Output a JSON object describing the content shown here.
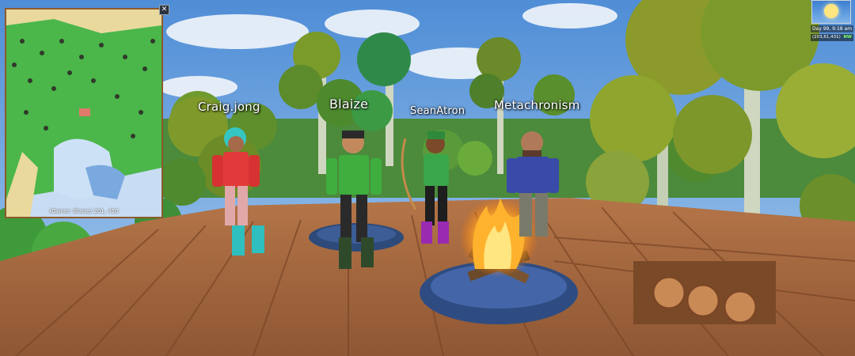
{
  "players": [
    {
      "name": "Craig.jong"
    },
    {
      "name": "Blaize"
    },
    {
      "name": "SeanAtron"
    },
    {
      "name": "Metachronism"
    }
  ],
  "minimap": {
    "owner_label": "(Owner: Blaize) 201, 450",
    "close_label": "✕"
  },
  "hud": {
    "day_time": "Day 99, 9:18 am",
    "coords": "(203,61,431)",
    "compass": "NW",
    "weather_icon": "sun-icon"
  },
  "colors": {
    "sky": "#6ea3d8",
    "deck": "#a86a3f",
    "foliage": "#6f9a2e",
    "fire": "#ffb22e"
  }
}
